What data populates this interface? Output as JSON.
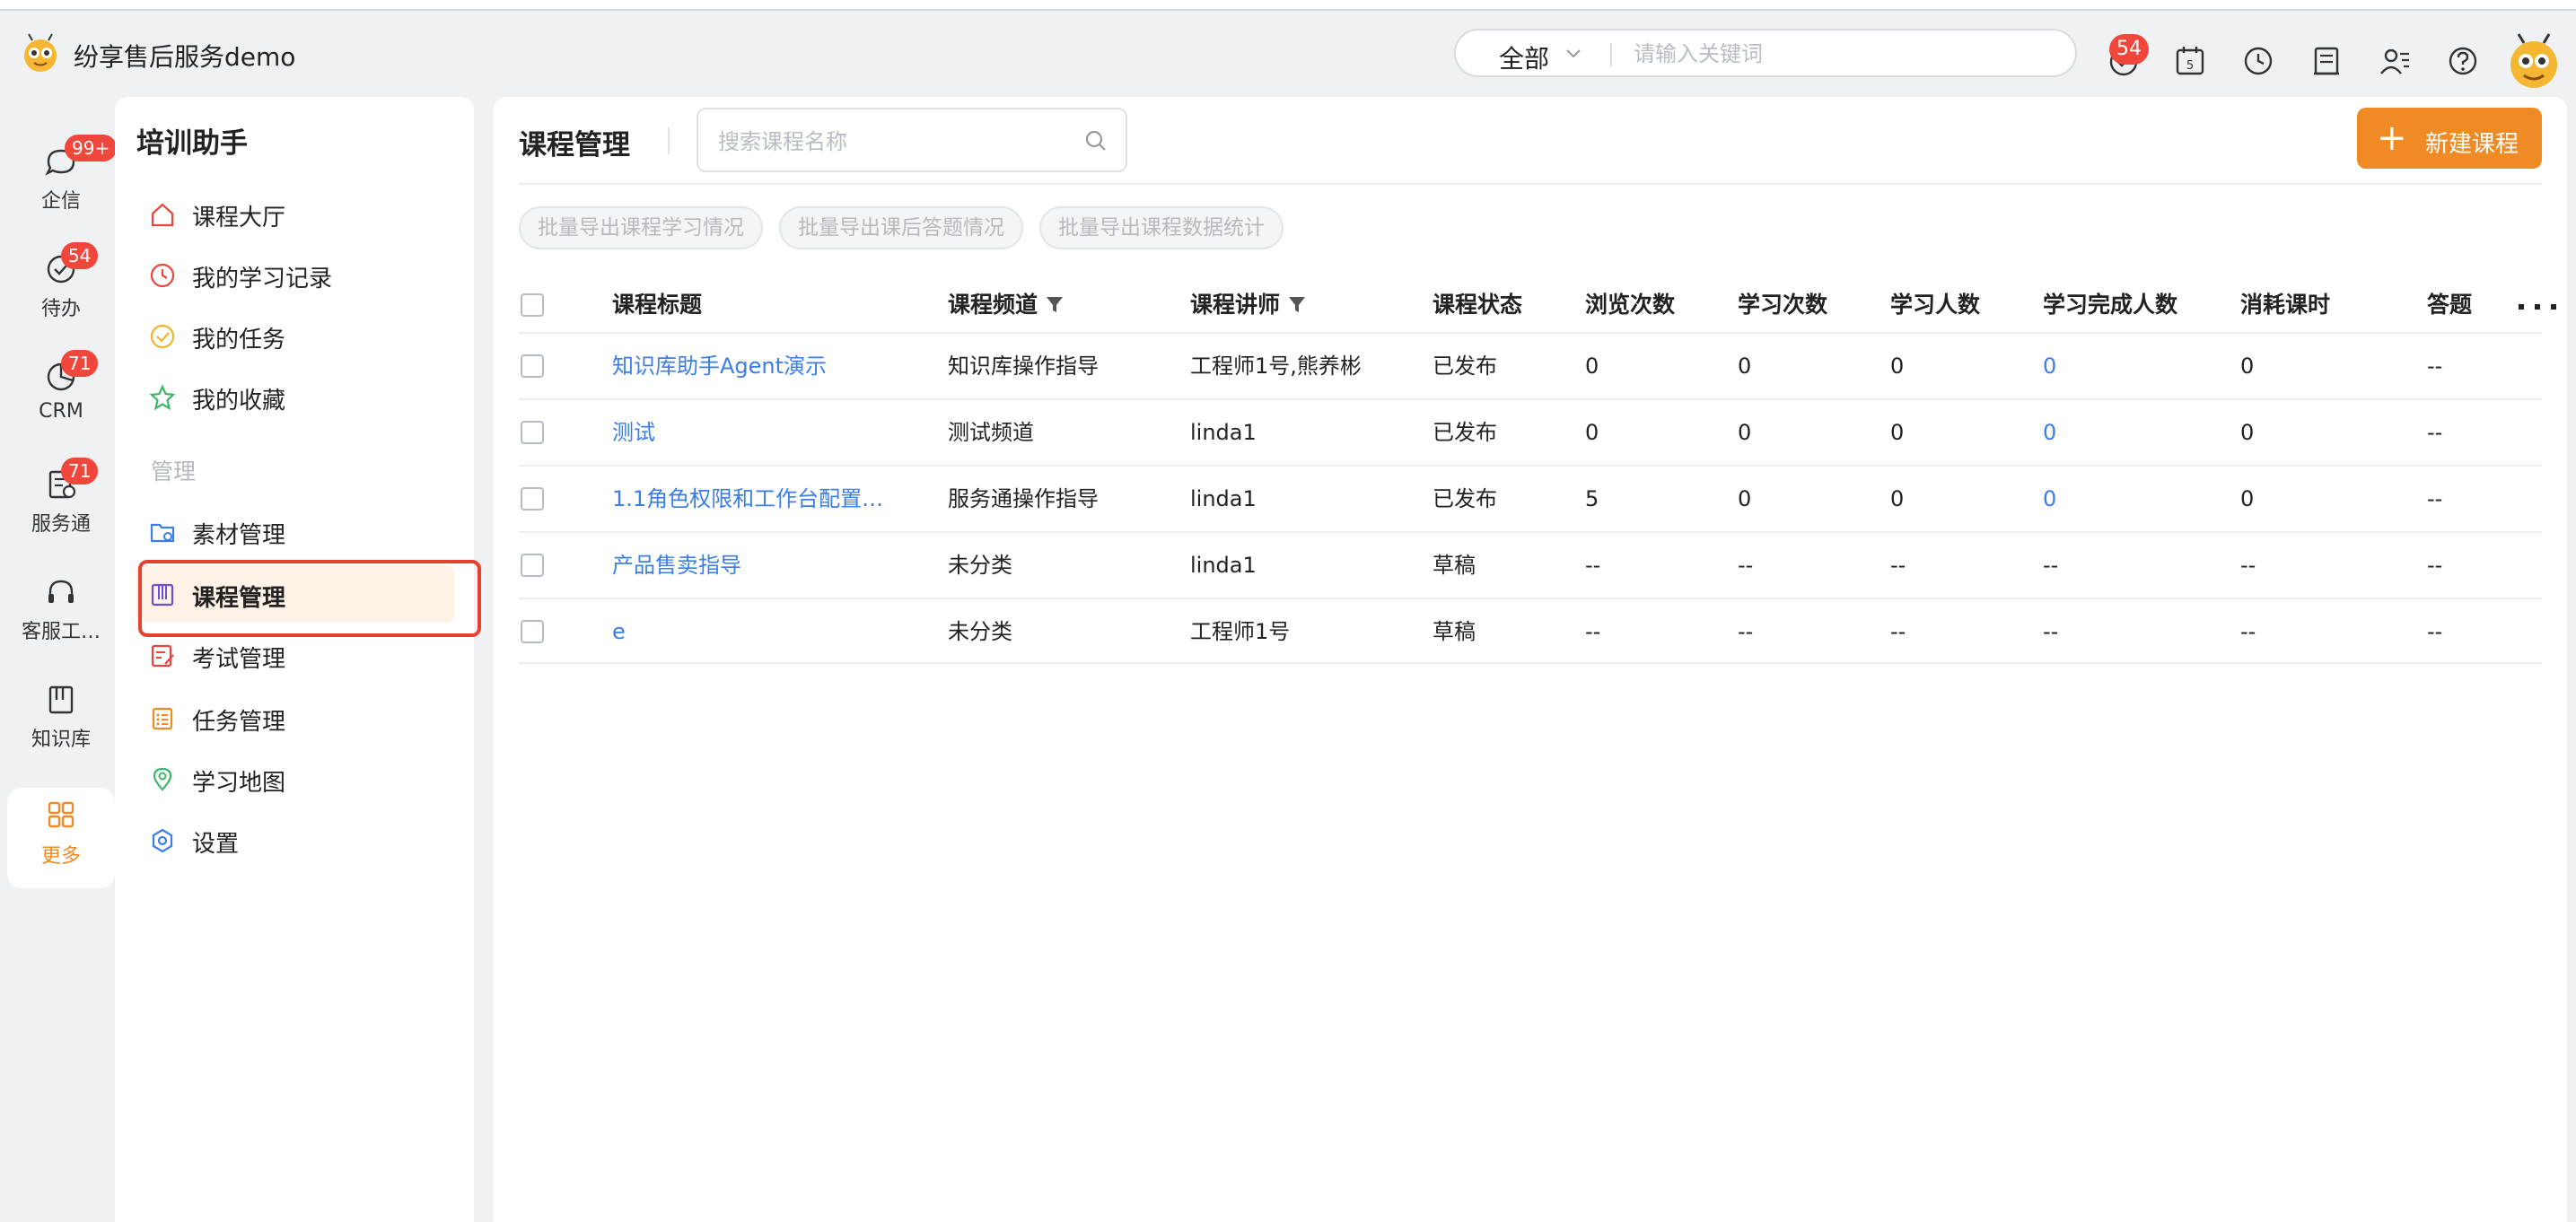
{
  "app": {
    "title": "纷享售后服务demo"
  },
  "topbar": {
    "scope": "全部",
    "search_placeholder": "请输入关键词",
    "notif_badge": "54",
    "icons": [
      "heart-bell-icon",
      "calendar-icon",
      "clock-icon",
      "inbox-icon",
      "users-icon",
      "help-icon"
    ]
  },
  "rail": {
    "items": [
      {
        "label": "企信",
        "icon": "chat-icon",
        "badge": "99+"
      },
      {
        "label": "待办",
        "icon": "check-circle-icon",
        "badge": "54"
      },
      {
        "label": "CRM",
        "icon": "pie-chart-icon",
        "badge": "71"
      },
      {
        "label": "服务通",
        "icon": "service-icon",
        "badge": "71"
      },
      {
        "label": "客服工…",
        "icon": "headset-icon",
        "badge": ""
      },
      {
        "label": "知识库",
        "icon": "book-icon",
        "badge": ""
      },
      {
        "label": "更多",
        "icon": "grid-icon",
        "badge": "",
        "active": true
      }
    ]
  },
  "sidebar": {
    "title": "培训助手",
    "items": [
      {
        "label": "课程大厅",
        "icon": "home-icon"
      },
      {
        "label": "我的学习记录",
        "icon": "clock-icon"
      },
      {
        "label": "我的任务",
        "icon": "check-icon"
      },
      {
        "label": "我的收藏",
        "icon": "star-icon"
      }
    ],
    "group_label": "管理",
    "manage_items": [
      {
        "label": "素材管理",
        "icon": "folder-icon"
      },
      {
        "label": "课程管理",
        "icon": "course-icon",
        "active": true
      },
      {
        "label": "考试管理",
        "icon": "exam-icon"
      },
      {
        "label": "任务管理",
        "icon": "task-list-icon"
      },
      {
        "label": "学习地图",
        "icon": "map-pin-icon"
      },
      {
        "label": "设置",
        "icon": "settings-icon"
      }
    ]
  },
  "main": {
    "title": "课程管理",
    "search_placeholder": "搜索课程名称",
    "new_button": "新建课程",
    "batch_buttons": [
      "批量导出课程学习情况",
      "批量导出课后答题情况",
      "批量导出课程数据统计"
    ],
    "columns": [
      "课程标题",
      "课程频道",
      "课程讲师",
      "课程状态",
      "浏览次数",
      "学习次数",
      "学习人数",
      "学习完成人数",
      "消耗课时",
      "答题"
    ],
    "rows": [
      [
        "知识库助手Agent演示",
        "知识库操作指导",
        "工程师1号,熊养彬",
        "已发布",
        "0",
        "0",
        "0",
        "0",
        "0",
        "--"
      ],
      [
        "测试",
        "测试频道",
        "linda1",
        "已发布",
        "0",
        "0",
        "0",
        "0",
        "0",
        "--"
      ],
      [
        "1.1角色权限和工作台配置…",
        "服务通操作指导",
        "linda1",
        "已发布",
        "5",
        "0",
        "0",
        "0",
        "0",
        "--"
      ],
      [
        "产品售卖指导",
        "未分类",
        "linda1",
        "草稿",
        "--",
        "--",
        "--",
        "--",
        "--",
        "--"
      ],
      [
        "e",
        "未分类",
        "工程师1号",
        "草稿",
        "--",
        "--",
        "--",
        "--",
        "--",
        "--"
      ]
    ]
  },
  "colors": {
    "accent": "#f08a24",
    "link": "#3b7ee8",
    "badge": "#f0463c",
    "highlight": "#e8402f"
  }
}
